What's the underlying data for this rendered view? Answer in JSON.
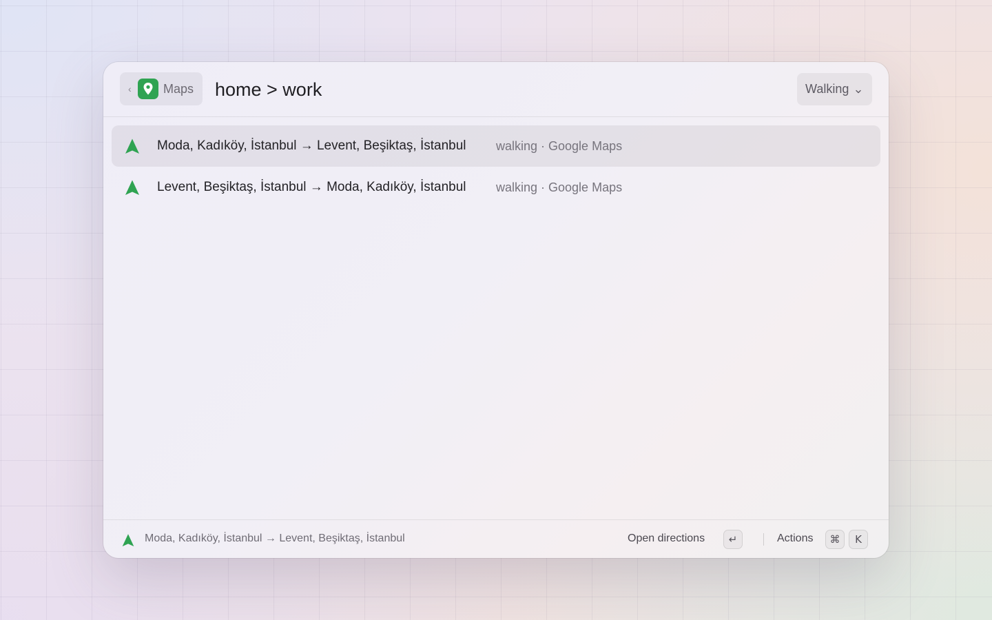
{
  "colors": {
    "accent_green": "#2fa352"
  },
  "header": {
    "back_label": "Maps",
    "back_chevron": "‹",
    "query": "home > work",
    "mode": "Walking"
  },
  "results": [
    {
      "icon": "navigation-arrow-icon",
      "title": "Moda, Kadıköy, İstanbul → Levent, Beşiktaş, İstanbul",
      "subtitle": "walking · Google Maps",
      "selected": true
    },
    {
      "icon": "navigation-arrow-icon",
      "title": "Levent, Beşiktaş, İstanbul → Moda, Kadıköy, İstanbul",
      "subtitle": "walking · Google Maps",
      "selected": false
    }
  ],
  "footer": {
    "selected_text": "Moda, Kadıköy, İstanbul → Levent, Beşiktaş, İstanbul",
    "primary_action": "Open directions",
    "primary_key": "↵",
    "secondary_action": "Actions",
    "secondary_key_modifier": "⌘",
    "secondary_key": "K"
  }
}
